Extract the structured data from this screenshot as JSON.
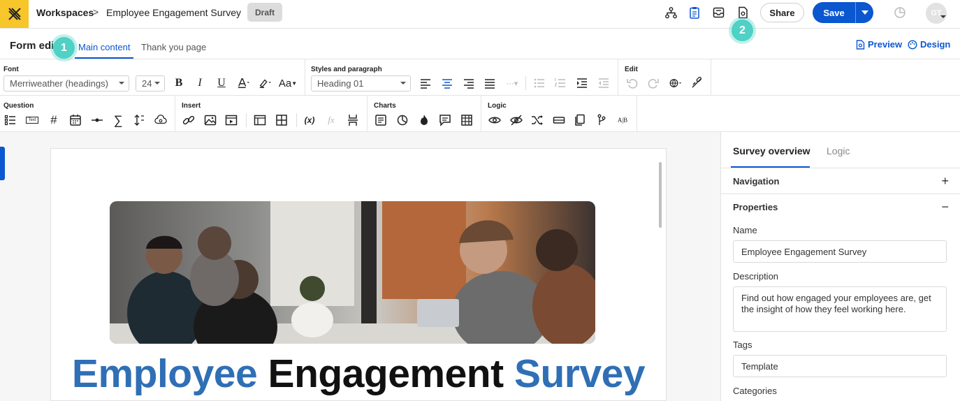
{
  "header": {
    "workspaces_label": "Workspaces",
    "separator": ">",
    "survey_title": "Employee Engagement Survey",
    "status_badge": "Draft",
    "share_label": "Share",
    "save_label": "Save",
    "avatar_initials": "GT"
  },
  "tutorial_badges": {
    "first": "1",
    "second": "2"
  },
  "tabs": {
    "section_title": "Form edit",
    "items": [
      "Main content",
      "Thank you page"
    ],
    "preview_label": "Preview",
    "design_label": "Design"
  },
  "toolbar": {
    "font_group": "Font",
    "font_family_value": "Merriweather (headings)",
    "font_size_value": "24",
    "styles_group": "Styles and paragraph",
    "style_value": "Heading 01",
    "edit_group": "Edit",
    "question_group": "Question",
    "insert_group": "Insert",
    "charts_group": "Charts",
    "logic_group": "Logic",
    "text_chip": "Text",
    "ab_label": "A|B",
    "fx_label": "fx",
    "var_label": "(x)"
  },
  "canvas": {
    "headline_part1": "Employee",
    "headline_part2": "Engagement",
    "headline_part3": "Survey"
  },
  "right_panel": {
    "tabs": [
      "Survey overview",
      "Logic"
    ],
    "navigation_label": "Navigation",
    "properties_label": "Properties",
    "name_label": "Name",
    "name_value": "Employee Engagement Survey",
    "description_label": "Description",
    "description_value": "Find out how engaged your employees are,  get the insight of how they feel working here.",
    "tags_label": "Tags",
    "tags_value": "Template",
    "categories_label": "Categories"
  },
  "colors": {
    "accent": "#0b57d0",
    "logo_bg": "#f6c62b",
    "headline_blue": "#2f6fb5",
    "badge_teal": "#4fd1c5"
  }
}
